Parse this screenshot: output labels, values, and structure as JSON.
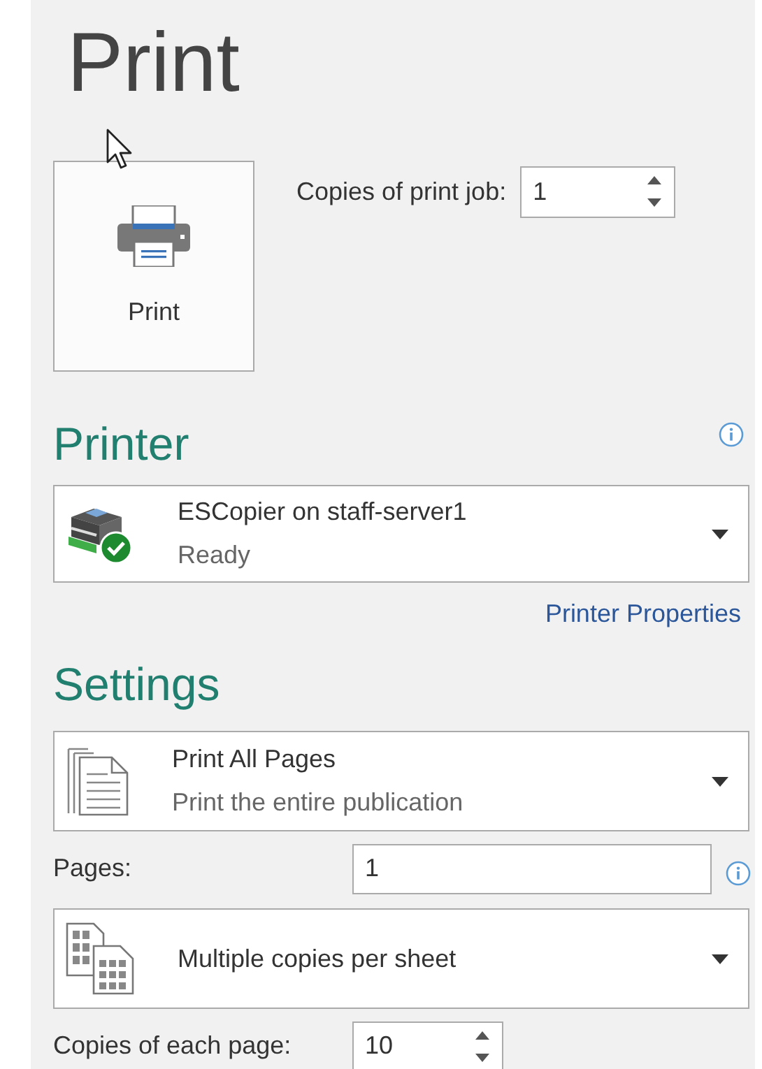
{
  "title": "Print",
  "print_button": {
    "label": "Print"
  },
  "copies": {
    "label": "Copies of print job:",
    "value": "1"
  },
  "printer": {
    "heading": "Printer",
    "name": "ESCopier on staff-server1",
    "status": "Ready",
    "properties_link": "Printer Properties"
  },
  "settings": {
    "heading": "Settings",
    "items": [
      {
        "kind": "dropdown",
        "title": "Print All Pages",
        "subtitle": "Print the entire publication"
      },
      {
        "kind": "text_field",
        "label": "Pages:",
        "value": "1"
      },
      {
        "kind": "dropdown",
        "title": "Multiple copies per sheet"
      },
      {
        "kind": "spinner",
        "label": "Copies of each page:",
        "value": "10"
      }
    ]
  }
}
